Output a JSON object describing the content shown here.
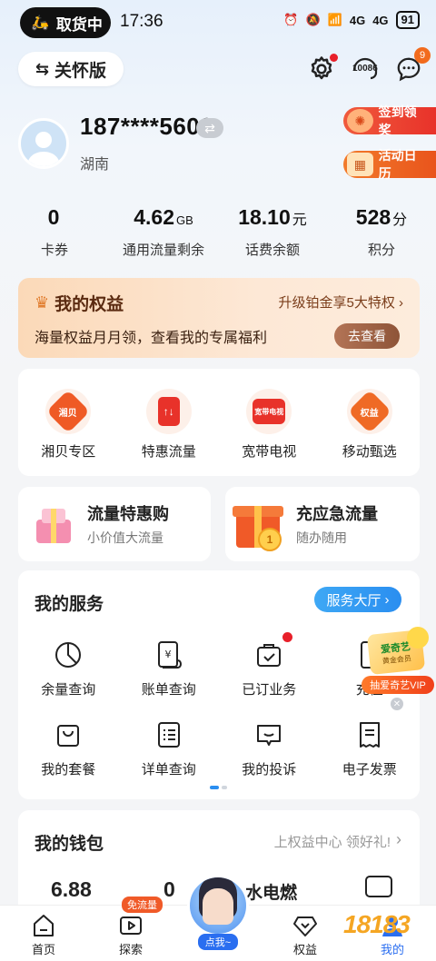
{
  "status_bar": {
    "pill_label": "取货中",
    "time": "17:36",
    "battery": "91",
    "signal_1": "4G",
    "signal_2": "4G"
  },
  "header": {
    "care_mode_label": "关怀版",
    "service_number": "10086",
    "message_badge": "9"
  },
  "profile": {
    "phone": "187****5603",
    "region": "湖南",
    "checkin_label": "签到领奖",
    "calendar_label": "活动日历"
  },
  "stats": [
    {
      "value": "0",
      "unit": "",
      "label": "卡券"
    },
    {
      "value": "4.62",
      "unit": "GB",
      "label": "通用流量剩余"
    },
    {
      "value": "18.10",
      "unit": "元",
      "label": "话费余额"
    },
    {
      "value": "528",
      "unit": "分",
      "label": "积分"
    }
  ],
  "equity": {
    "title": "我的权益",
    "upgrade": "升级铂金享5大特权",
    "desc": "海量权益月月领，查看我的专属福利",
    "button": "去查看"
  },
  "quick": [
    {
      "icon_text": "湘贝",
      "label": "湘贝专区"
    },
    {
      "icon_text": "↑↓",
      "label": "特惠流量"
    },
    {
      "icon_text": "宽带电视",
      "label": "宽带电视"
    },
    {
      "icon_text": "权益",
      "label": "移动甄选"
    }
  ],
  "promos": {
    "left": {
      "title": "流量特惠购",
      "sub": "小价值大流量"
    },
    "right": {
      "title": "充应急流量",
      "sub": "随办随用",
      "coin_text": "1"
    }
  },
  "services": {
    "title": "我的服务",
    "hall_button": "服务大厅",
    "row1": [
      {
        "label": "余量查询",
        "icon": "pie-chart-icon"
      },
      {
        "label": "账单查询",
        "icon": "bill-icon"
      },
      {
        "label": "已订业务",
        "icon": "bag-icon"
      },
      {
        "label": "充值",
        "icon": "topup-icon"
      }
    ],
    "row2": [
      {
        "label": "我的套餐",
        "icon": "package-icon"
      },
      {
        "label": "详单查询",
        "icon": "detail-list-icon"
      },
      {
        "label": "我的投诉",
        "icon": "complaint-icon"
      },
      {
        "label": "电子发票",
        "icon": "invoice-icon"
      }
    ],
    "iqiyi_badge": "爱奇艺",
    "iqiyi_sub": "黄金会员",
    "iqiyi_ribbon": "抽爱奇艺VIP"
  },
  "wallet": {
    "title": "我的钱包",
    "link": "上权益中心 领好礼!",
    "value_1": "6.88",
    "value_2": "0",
    "utility_label": "水电燃"
  },
  "nav": {
    "items": [
      {
        "label": "首页"
      },
      {
        "label": "探索",
        "badge": "免流量"
      },
      {
        "label": "点我~"
      },
      {
        "label": "权益"
      },
      {
        "label": "我的"
      }
    ],
    "watermark": "18183"
  }
}
